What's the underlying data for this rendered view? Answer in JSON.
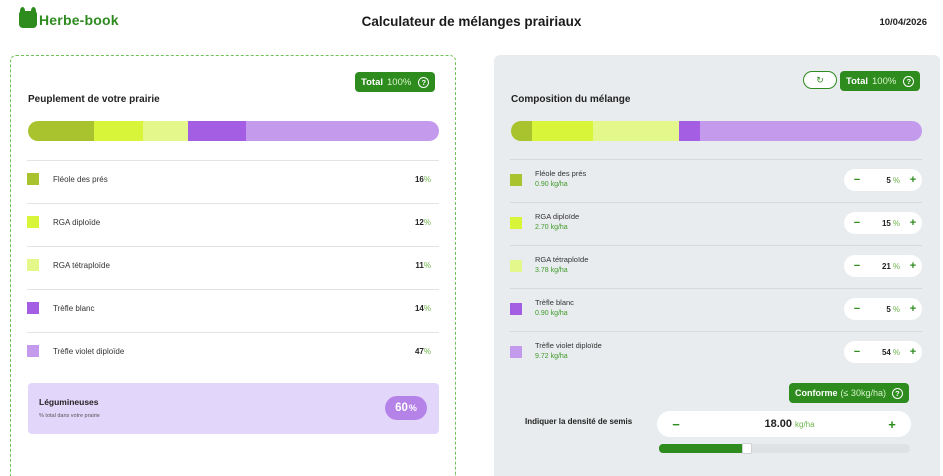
{
  "header": {
    "brand": "Herbe-book",
    "title": "Calculateur de mélanges prairiaux",
    "date": "10/04/2026"
  },
  "colors": {
    "brand_green": "#2e8b1e",
    "fleole": "#a8c32e",
    "rga_diploide": "#d9f53a",
    "rga_tetraploide": "#e3f78a",
    "trefle_blanc": "#a35ee3",
    "trefle_violet": "#c49bec",
    "legume_badge": "#b583e8"
  },
  "left": {
    "total_label": "Total",
    "total_value": "100%",
    "title": "Peuplement de votre prairie",
    "species": [
      {
        "name": "Fléole des prés",
        "value": "16",
        "fraction": 0.16,
        "color": "#a8c32e"
      },
      {
        "name": "RGA diploïde",
        "value": "12",
        "fraction": 0.12,
        "color": "#d9f53a"
      },
      {
        "name": "RGA tétraploïde",
        "value": "11",
        "fraction": 0.11,
        "color": "#e3f78a"
      },
      {
        "name": "Trèfle blanc",
        "value": "14",
        "fraction": 0.14,
        "color": "#a35ee3"
      },
      {
        "name": "Trèfle violet diploïde",
        "value": "47",
        "fraction": 0.47,
        "color": "#c49bec"
      }
    ],
    "pct_symbol": "%",
    "legumes": {
      "title": "Légumineuses",
      "subtitle": "% total dans votre prairie",
      "value": "60",
      "symbol": "%"
    }
  },
  "right": {
    "reset_icon": "↻",
    "total_label": "Total",
    "total_value": "100%",
    "title": "Composition du mélange",
    "species": [
      {
        "name": "Fléole des prés",
        "rate": "0.90 kg/ha",
        "value": "5",
        "fraction": 0.05,
        "color": "#a8c32e"
      },
      {
        "name": "RGA diploïde",
        "rate": "2.70 kg/ha",
        "value": "15",
        "fraction": 0.15,
        "color": "#d9f53a"
      },
      {
        "name": "RGA tétraploïde",
        "rate": "3.78 kg/ha",
        "value": "21",
        "fraction": 0.21,
        "color": "#e3f78a"
      },
      {
        "name": "Trèfle blanc",
        "rate": "0.90 kg/ha",
        "value": "5",
        "fraction": 0.05,
        "color": "#a35ee3"
      },
      {
        "name": "Trèfle violet diploïde",
        "rate": "9.72 kg/ha",
        "value": "54",
        "fraction": 0.54,
        "color": "#c49bec"
      }
    ],
    "stepper_minus": "−",
    "stepper_plus": "+",
    "pct_symbol": "%",
    "conform": {
      "label": "Conforme",
      "note": "(≤ 30kg/ha)"
    },
    "density": {
      "label": "Indiquer la densité de semis",
      "value": "18.00",
      "unit": "kg/ha",
      "minus": "−",
      "plus": "+",
      "slider_fraction": 0.33
    }
  }
}
